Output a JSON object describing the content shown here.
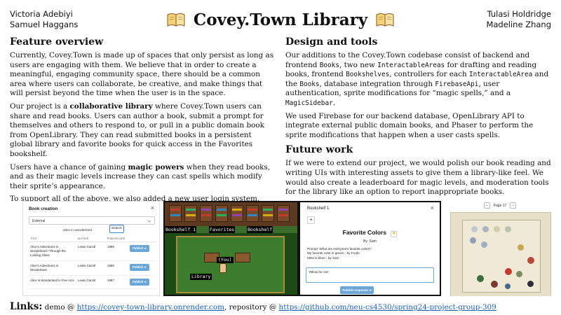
{
  "header": {
    "authors_left": [
      "Victoria Adebiyi",
      "Samuel Haggans"
    ],
    "authors_right": [
      "Tulasi Holdridge",
      "Madeline Zhang"
    ],
    "title": "Covey.Town Library",
    "title_icon": "open-book-icon"
  },
  "feature_overview": {
    "heading": "Feature overview",
    "p1": "Currently, Covey.Town is made up of spaces that only persist as long as users are engaging with them. We believe that in order to create a meaningful, engaging community space, there should be a common area where users can collaborate, be creative, and make things that will persist beyond the time when the user is in the space.",
    "p2_a": "Our project is a ",
    "p2_bold": "collaborative library",
    "p2_b": " where Covey.Town users can share and read books. Users can author a book, submit a prompt for themselves and others to respond to, or pull in a public domain book from OpenLibrary. They can read submitted books in a persistent global library and favorite books for quick access in the Favorites bookshelf.",
    "p3_a": "Users have a chance of gaining ",
    "p3_bold": "magic powers",
    "p3_b": " when they read books, and as their magic levels increase they can cast spells which modify their sprite’s appearance.",
    "p4": "To support all of the above, we also added a new user login system."
  },
  "design_tools": {
    "heading": "Design and tools",
    "p1_a": "Our additions to the Covey.Town codebase consist of backend and frontend ",
    "p1_c1": "Books",
    "p1_b": ", two new ",
    "p1_c2": "InteractableAreas",
    "p1_c": " for drafting and reading books, frontend ",
    "p1_c3": "Bookshelves",
    "p1_d": ", controllers for each ",
    "p1_c4": "InteractableArea",
    "p1_e": " and the ",
    "p1_c5": "Books",
    "p1_f": ", database integration through ",
    "p1_c6": "FirebaseApi",
    "p1_g": ", user authentication, sprite modifications for “magic spells,” and a ",
    "p1_c7": "MagicSidebar",
    "p1_h": ".",
    "p2": "We used Firebase for our backend database, OpenLibrary API to integrate external public domain books, and Phaser to perform the sprite modifications that happen when a user casts spells."
  },
  "future_work": {
    "heading": "Future work",
    "p1": "If we were to extend our project, we would polish our book reading and writing UIs with interesting assets to give them a library-like feel. We would also create a leaderboard for magic levels, and moderation tools for the library like an option to report inappropriate books."
  },
  "screenshot_book_creation": {
    "title": "Book creation",
    "close": "×",
    "source_select": "External",
    "search_value": "alice in wonderland",
    "search_button": "Search",
    "columns": [
      "TITLE",
      "AUTHOR",
      "PUBLISH DATE",
      ""
    ],
    "rows": [
      {
        "title": "Alice's Adventures in Wonderland / Through the Looking Glass",
        "author": "Lewis Carroll",
        "date": "1889",
        "action": "Publish ➔"
      },
      {
        "title": "Alice's Adventures in Wonderland",
        "author": "Lewis Carroll",
        "date": "1865",
        "action": "Publish ➔"
      },
      {
        "title": "Alice in Wonderland in Five Acts",
        "author": "Lewis Carroll",
        "date": "1897",
        "action": "Publish ➔"
      }
    ]
  },
  "screenshot_game": {
    "label_bookshelf": "Bookshelf 1",
    "label_favorites": "Favorites",
    "label_bookshelf2": "Bookshelf",
    "label_you": "(You)",
    "label_library": "Library"
  },
  "screenshot_bookshelf": {
    "title": "Bookshelf 1",
    "close": "×",
    "add": "+",
    "book_title": "Favorite Colors",
    "star": "★",
    "by": "By: Sam",
    "lines": [
      "Prompt: What are everyone's favorite colors?",
      "My favorite color is green! - by Frodo",
      "Mine is blue! - by Sam"
    ],
    "input_value": "Yellow for me!",
    "publish_button": "Publish response ➔"
  },
  "screenshot_page": {
    "prev": "←",
    "page_label": "Page 17",
    "next": "→"
  },
  "links": {
    "lead": "Links:",
    "demo_label": " demo @ ",
    "demo_url": "https://covey-town-library.onrender.com",
    "sep": ", repository @ ",
    "repo_url": "https://github.com/neu-cs4530/spring24-project-group-309"
  },
  "colors": {
    "link": "#1a5fb4",
    "publish_button": "#6aa6d8",
    "game_floor": "#3c7d2e",
    "game_wall": "#5b3a21"
  }
}
